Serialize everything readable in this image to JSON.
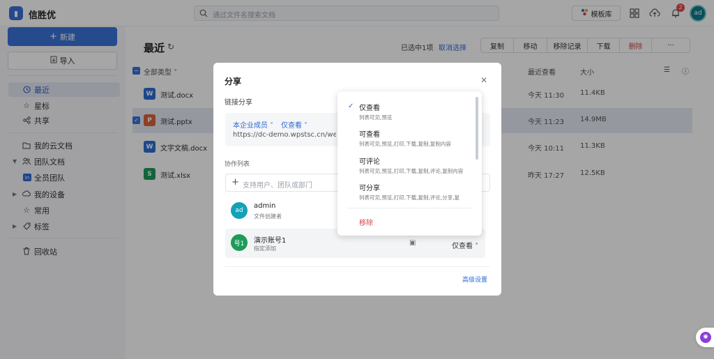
{
  "app": {
    "name": "信胜优"
  },
  "search": {
    "placeholder": "通过文件名搜索文档"
  },
  "topbar": {
    "template_label": "模板库",
    "notification_count": "2",
    "avatar_initials": "ad"
  },
  "sidebar": {
    "new_label": "新建",
    "import_label": "导入",
    "items": [
      {
        "label": "最近",
        "icon": "clock-icon"
      },
      {
        "label": "星标",
        "icon": "star-icon"
      },
      {
        "label": "共享",
        "icon": "share-icon"
      },
      {
        "label": "我的云文档",
        "icon": "folder-icon"
      },
      {
        "label": "团队文档",
        "icon": "team-icon"
      },
      {
        "label": "全员团队",
        "icon": "team-folder-icon"
      },
      {
        "label": "我的设备",
        "icon": "device-icon"
      },
      {
        "label": "常用",
        "icon": "pin-icon"
      },
      {
        "label": "标签",
        "icon": "tag-icon"
      },
      {
        "label": "回收站",
        "icon": "trash-icon"
      }
    ]
  },
  "main": {
    "title": "最近",
    "selected_info": "已选中1项",
    "cancel_select": "取消选择",
    "actions": [
      "复制",
      "移动",
      "移除记录",
      "下载",
      "删除",
      "···"
    ],
    "columns": {
      "type": "全部类型",
      "last_viewed": "最近查看",
      "size": "大小"
    },
    "files": [
      {
        "name": "测试.docx",
        "type": "W",
        "color": "#2b6fd6",
        "time": "今天 11:30",
        "size": "11.4KB"
      },
      {
        "name": "测试.pptx",
        "type": "P",
        "color": "#d9643a",
        "time": "今天 11:23",
        "size": "14.9MB"
      },
      {
        "name": "文字文稿.docx",
        "type": "W",
        "color": "#2b6fd6",
        "time": "今天 10:11",
        "size": "11.3KB"
      },
      {
        "name": "测试.xlsx",
        "type": "S",
        "color": "#1e9b59",
        "time": "昨天 17:27",
        "size": "12.5KB"
      }
    ]
  },
  "modal": {
    "title": "分享",
    "link_share_label": "链接分享",
    "scope": "本企业成员",
    "permission": "仅查看",
    "url": "https://dc-demo.wpstsc.cn/weboffic",
    "collab_label": "协作列表",
    "add_placeholder": "支持用户、团队或部门",
    "members": [
      {
        "initials": "ad",
        "name": "admin",
        "desc": "文件创建者",
        "color": "#12a2b8"
      },
      {
        "initials": "号1",
        "name": "演示账号1",
        "desc": "指定添加",
        "color": "#1e9b59",
        "perm": "仅查看"
      }
    ],
    "advanced_label": "高级设置"
  },
  "dropdown": {
    "options": [
      {
        "label": "仅查看",
        "desc": "列表可见,预览",
        "checked": true
      },
      {
        "label": "可查看",
        "desc": "列表可见,预览,打印,下载,复制,复制内容"
      },
      {
        "label": "可评论",
        "desc": "列表可见,预览,打印,下载,复制,评论,复制内容"
      },
      {
        "label": "可分享",
        "desc": "列表可见,预览,打印,下载,复制,评论,分享,复"
      }
    ],
    "remove_label": "移除"
  },
  "colors": {
    "accent": "#3a72d9",
    "danger": "#d64545"
  }
}
